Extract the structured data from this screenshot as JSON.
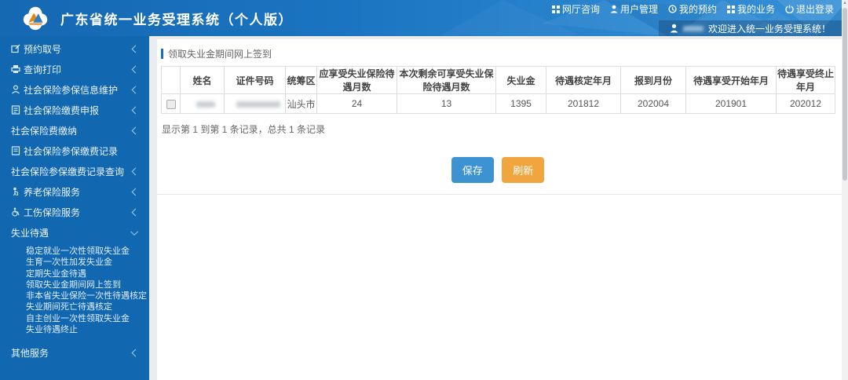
{
  "app": {
    "title": "广东省统一业务受理系统（个人版）"
  },
  "topbar": {
    "links": [
      {
        "label": "网厅咨询",
        "icon": "grid-icon"
      },
      {
        "label": "用户管理",
        "icon": "user-icon"
      },
      {
        "label": "我的预约",
        "icon": "history-icon"
      },
      {
        "label": "我的业务",
        "icon": "grid-icon"
      },
      {
        "label": "退出登录",
        "icon": "power-icon"
      }
    ],
    "welcome": "欢迎进入统一业务受理系统！",
    "user_name_redacted": true
  },
  "sidebar": {
    "items": [
      {
        "label": "预约取号",
        "icon": "edit-icon",
        "state": "collapsed"
      },
      {
        "label": "查询打印",
        "icon": "printer-icon",
        "state": "collapsed"
      },
      {
        "label": "社会保险参保信息维护",
        "icon": "person-icon",
        "state": "collapsed"
      },
      {
        "label": "社会保险缴费申报",
        "icon": "report-icon",
        "state": "collapsed"
      },
      {
        "label": "社会保险费缴纳",
        "icon": null,
        "state": "collapsed"
      },
      {
        "label": "社会保险参保缴费记录",
        "icon": "record-icon",
        "state": "none"
      },
      {
        "label": "社会保险参保缴费记录查询",
        "icon": null,
        "state": "collapsed"
      },
      {
        "label": "养老保险服务",
        "icon": "elder-icon",
        "state": "collapsed"
      },
      {
        "label": "工伤保险服务",
        "icon": "wheelchair-icon",
        "state": "collapsed"
      },
      {
        "label": "失业待遇",
        "icon": null,
        "state": "expanded"
      },
      {
        "label": "其他服务",
        "icon": null,
        "state": "collapsed"
      }
    ],
    "unemployment_submenu": [
      "稳定就业一次性领取失业金",
      "生育一次性加发失业金",
      "定期失业金待遇",
      "领取失业金期间网上签到",
      "非本省失业保险一次性待遇核定",
      "失业期间死亡待遇核定",
      "自主创业一次性领取失业金",
      "失业待遇终止"
    ]
  },
  "main": {
    "page_title": "领取失业金期间网上签到",
    "table": {
      "columns": [
        "",
        "姓名",
        "证件号码",
        "统筹区",
        "应享受失业保险待遇月数",
        "本次剩余可享受失业保险待遇月数",
        "失业金",
        "待遇核定年月",
        "报到月份",
        "待遇享受开始年月",
        "待遇享受终止年月"
      ],
      "rows": [
        {
          "name_redacted": true,
          "id_redacted": true,
          "region": "汕头市",
          "entitled_months": "24",
          "remaining_months": "13",
          "benefit_amount": "1395",
          "approval_month": "201812",
          "report_month": "202004",
          "start_month": "201901",
          "end_month": "202012"
        }
      ]
    },
    "pagination_summary": "显示第 1 到第 1 条记录，总共 1 条记录",
    "buttons": {
      "save": "保存",
      "refresh": "刷新"
    }
  },
  "colors": {
    "header_blue": "#1b74c1",
    "sidebar_blue": "#1267b1",
    "title_accent": "#1470c0",
    "save_button": "#3d93d1",
    "refresh_button": "#f0a53e",
    "table_border": "#dddddd"
  }
}
